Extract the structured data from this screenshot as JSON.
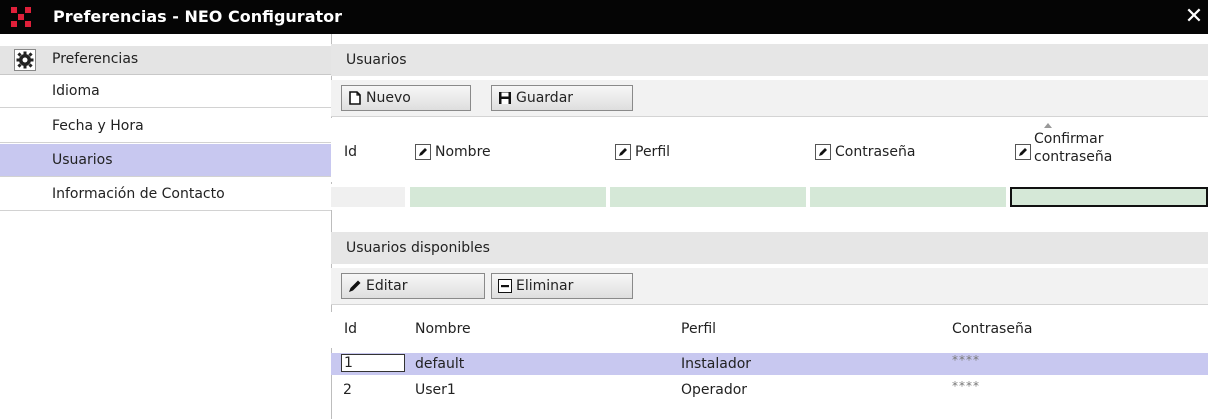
{
  "window": {
    "title": "Preferencias - NEO Configurator"
  },
  "sidebar": {
    "header": "Preferencias",
    "items": [
      {
        "label": "Idioma"
      },
      {
        "label": "Fecha y Hora"
      },
      {
        "label": "Usuarios",
        "selected": true
      },
      {
        "label": "Información de Contacto"
      }
    ]
  },
  "users_section": {
    "title": "Usuarios",
    "new_label": "Nuevo",
    "save_label": "Guardar",
    "columns": {
      "id": "Id",
      "name": "Nombre",
      "profile": "Perfil",
      "password": "Contraseña",
      "confirm_line1": "Confirmar",
      "confirm_line2": "contraseña"
    }
  },
  "available_section": {
    "title": "Usuarios disponibles",
    "edit_label": "Editar",
    "delete_label": "Eliminar",
    "columns": {
      "id": "Id",
      "name": "Nombre",
      "profile": "Perfil",
      "password": "Contraseña"
    },
    "rows": [
      {
        "id": "1",
        "name": "default",
        "profile": "Instalador",
        "password": "****",
        "selected": true
      },
      {
        "id": "2",
        "name": "User1",
        "profile": "Operador",
        "password": "****",
        "selected": false
      }
    ]
  },
  "colors": {
    "selection": "#c8c8f0",
    "input_fill": "#d5e8d7",
    "titlebar": "#050505"
  }
}
